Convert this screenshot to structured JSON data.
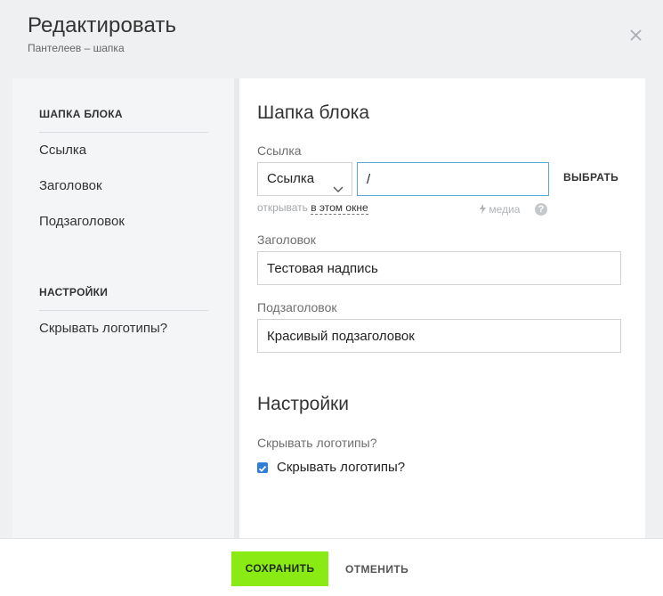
{
  "header": {
    "title": "Редактировать",
    "subtitle": "Пантелеев – шапка",
    "close_icon": "close-icon"
  },
  "sidebar": {
    "sections": [
      {
        "heading": "ШАПКА БЛОКА",
        "items": [
          "Ссылка",
          "Заголовок",
          "Подзаголовок"
        ]
      },
      {
        "heading": "НАСТРОЙКИ",
        "items": [
          "Скрывать логотипы?"
        ]
      }
    ]
  },
  "main": {
    "header_block": {
      "title": "Шапка блока",
      "link": {
        "label": "Ссылка",
        "select_value": "Ссылка",
        "url_value": "/",
        "choose_label": "ВЫБРАТЬ",
        "hint_prefix": "открывать",
        "hint_link": "в этом окне",
        "media_label": "медиа",
        "help_icon": "?"
      },
      "heading": {
        "label": "Заголовок",
        "value": "Тестовая надпись"
      },
      "subheading": {
        "label": "Подзаголовок",
        "value": "Красивый подзаголовок"
      }
    },
    "settings": {
      "title": "Настройки",
      "hide_logos_label": "Скрывать логотипы?",
      "hide_logos_checkbox_label": "Скрывать логотипы?",
      "hide_logos_checked": true
    }
  },
  "footer": {
    "save_label": "СОХРАНИТЬ",
    "cancel_label": "ОТМЕНИТЬ"
  },
  "colors": {
    "save_button": "#89ea14",
    "checkbox": "#2f7fd8",
    "active_input_border": "#5aa7d8",
    "background": "#eef0f1"
  }
}
